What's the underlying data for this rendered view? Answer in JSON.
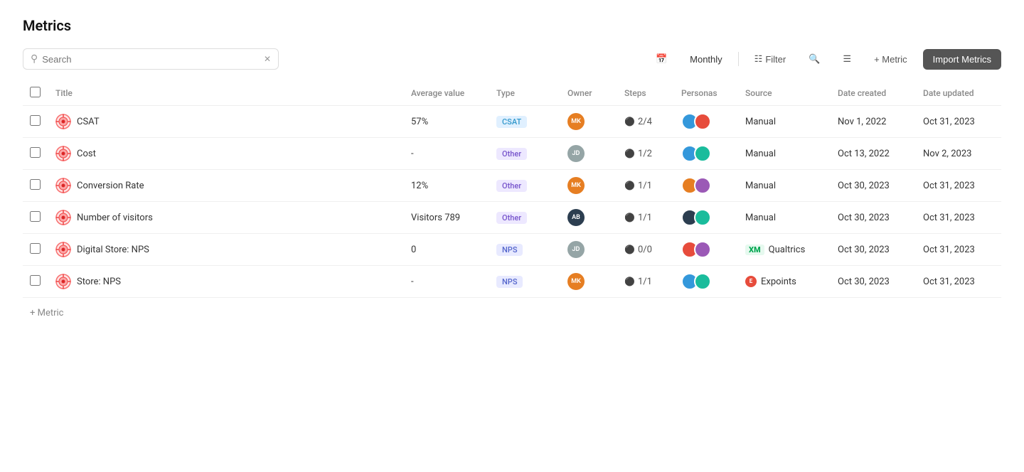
{
  "page": {
    "title": "Metrics"
  },
  "toolbar": {
    "search_placeholder": "Search",
    "monthly_label": "Monthly",
    "filter_label": "Filter",
    "add_metric_label": "+ Metric",
    "import_label": "Import Metrics"
  },
  "table": {
    "columns": {
      "title": "Title",
      "average_value": "Average value",
      "type": "Type",
      "owner": "Owner",
      "steps": "Steps",
      "personas": "Personas",
      "source": "Source",
      "date_created": "Date created",
      "date_updated": "Date updated"
    },
    "rows": [
      {
        "id": 1,
        "title": "CSAT",
        "average_value": "57%",
        "type": "CSAT",
        "type_class": "badge-csat",
        "owner_initials": "MK",
        "owner_color": "av-1",
        "steps": "2/4",
        "source": "Manual",
        "date_created": "Nov 1, 2022",
        "date_updated": "Oct 31, 2023"
      },
      {
        "id": 2,
        "title": "Cost",
        "average_value": "-",
        "type": "Other",
        "type_class": "badge-other",
        "owner_initials": "JD",
        "owner_color": "av-6",
        "steps": "1/2",
        "source": "Manual",
        "date_created": "Oct 13, 2022",
        "date_updated": "Nov 2, 2023"
      },
      {
        "id": 3,
        "title": "Conversion Rate",
        "average_value": "12%",
        "type": "Other",
        "type_class": "badge-other",
        "owner_initials": "MK",
        "owner_color": "av-1",
        "steps": "1/1",
        "source": "Manual",
        "date_created": "Oct 30, 2023",
        "date_updated": "Oct 31, 2023"
      },
      {
        "id": 4,
        "title": "Number of visitors",
        "average_value": "Visitors 789",
        "type": "Other",
        "type_class": "badge-other",
        "owner_initials": "AB",
        "owner_color": "av-8",
        "steps": "1/1",
        "source": "Manual",
        "date_created": "Oct 30, 2023",
        "date_updated": "Oct 31, 2023"
      },
      {
        "id": 5,
        "title": "Digital Store: NPS",
        "average_value": "0",
        "type": "NPS",
        "type_class": "badge-nps",
        "owner_initials": "JD",
        "owner_color": "av-6",
        "steps": "0/0",
        "source": "Qualtrics",
        "source_type": "xm",
        "date_created": "Oct 30, 2023",
        "date_updated": "Oct 31, 2023"
      },
      {
        "id": 6,
        "title": "Store: NPS",
        "average_value": "-",
        "type": "NPS",
        "type_class": "badge-nps",
        "owner_initials": "MK",
        "owner_color": "av-1",
        "steps": "1/1",
        "source": "Expoints",
        "source_type": "expo",
        "date_created": "Oct 30, 2023",
        "date_updated": "Oct 31, 2023"
      }
    ]
  },
  "add_metric": {
    "label": "+ Metric"
  }
}
